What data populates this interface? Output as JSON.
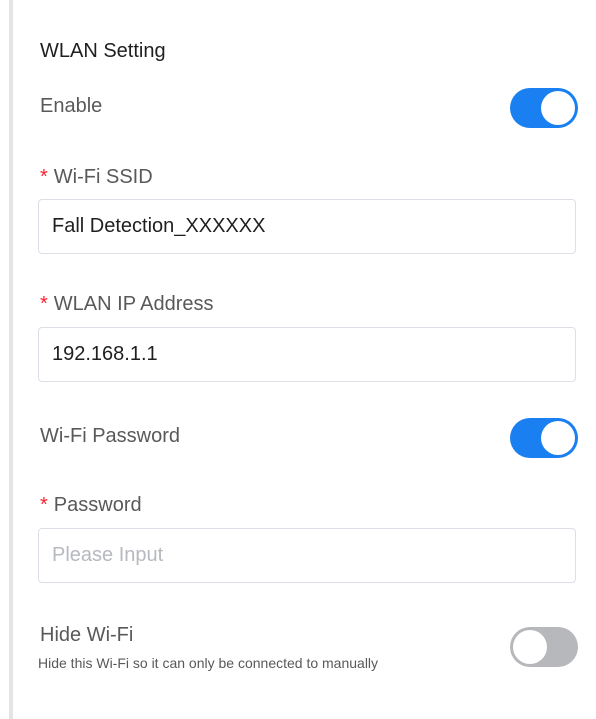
{
  "wlan": {
    "title": "WLAN Setting",
    "enable": {
      "label": "Enable",
      "on": true
    },
    "ssid": {
      "label": "Wi-Fi SSID",
      "required_mark": "*",
      "value": "Fall Detection_XXXXXX"
    },
    "ip": {
      "label": "WLAN IP Address",
      "required_mark": "*",
      "value": "192.168.1.1"
    },
    "wifi_password": {
      "label": "Wi-Fi Password",
      "on": true
    },
    "password": {
      "label": "Password",
      "required_mark": "*",
      "value": "",
      "placeholder": "Please Input"
    },
    "hide_wifi": {
      "label": "Hide Wi-Fi",
      "description": "Hide this Wi-Fi so it can only be connected to manually",
      "on": false
    }
  },
  "colors": {
    "toggle_on": "#1a7ff0",
    "toggle_off": "#b7b8bc",
    "required": "#f5222d"
  }
}
